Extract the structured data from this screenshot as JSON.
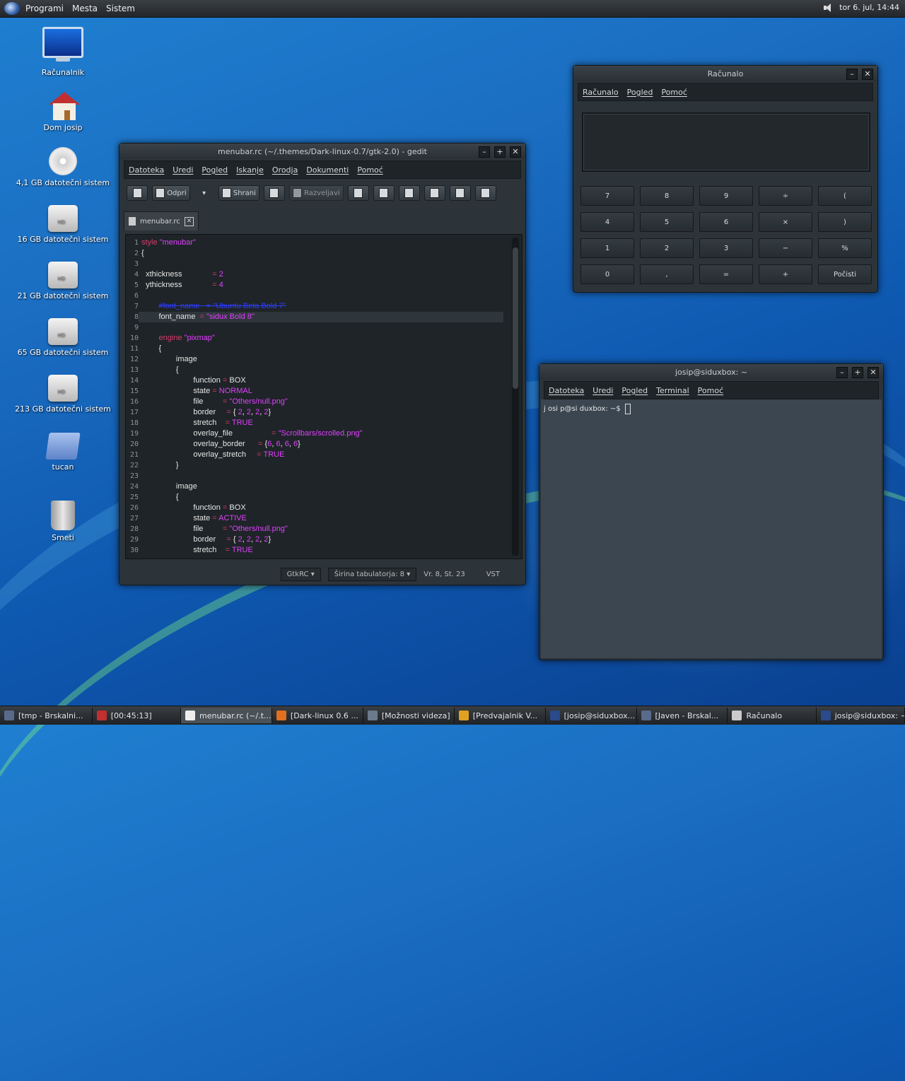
{
  "top_panel": {
    "menus": [
      "Programi",
      "Mesta",
      "Sistem"
    ],
    "clock": "tor  6. jul, 14:44"
  },
  "desktop_icons": [
    {
      "label": "Računalnik",
      "icon": "computer-icon"
    },
    {
      "label": "Dom josip",
      "icon": "home-folder-icon"
    },
    {
      "label": "4,1 GB datotečni sistem",
      "icon": "cd-drive-icon"
    },
    {
      "label": "16 GB datotečni sistem",
      "icon": "hard-drive-icon"
    },
    {
      "label": "21 GB datotečni sistem",
      "icon": "hard-drive-icon"
    },
    {
      "label": "65 GB datotečni sistem",
      "icon": "hard-drive-icon"
    },
    {
      "label": "213 GB datotečni sistem",
      "icon": "hard-drive-icon"
    },
    {
      "label": "tucan",
      "icon": "folder-icon"
    },
    {
      "label": "Smeti",
      "icon": "trash-icon"
    }
  ],
  "gedit": {
    "title": "menubar.rc (~/.themes/Dark-linux-0.7/gtk-2.0) - gedit",
    "menu": [
      "Datoteka",
      "Uredi",
      "Pogled",
      "Iskanje",
      "Orodja",
      "Dokumenti",
      "Pomoć"
    ],
    "toolbar": {
      "open": "Odpri",
      "save": "Shrani",
      "undo": "Razveljavi"
    },
    "tab": "menubar.rc",
    "line_numbers": [
      "1",
      "2",
      "3",
      "4",
      "5",
      "6",
      "7",
      "8",
      "9",
      "10",
      "11",
      "12",
      "13",
      "14",
      "15",
      "16",
      "17",
      "18",
      "19",
      "20",
      "21",
      "22",
      "23",
      "24",
      "25",
      "26",
      "27",
      "28",
      "29",
      "30"
    ],
    "status": {
      "lang": "GtkRC",
      "tab_width": "Širina tabulatorja:  8",
      "position": "Vr. 8, St. 23",
      "mode": "VST"
    }
  },
  "calculator": {
    "title": "Računalo",
    "menu": [
      "Računalo",
      "Pogled",
      "Pomoć"
    ],
    "buttons": [
      [
        "7",
        "8",
        "9",
        "÷",
        "("
      ],
      [
        "4",
        "5",
        "6",
        "×",
        ")"
      ],
      [
        "1",
        "2",
        "3",
        "−",
        "%"
      ],
      [
        "0",
        ",",
        "=",
        "+",
        "Počisti"
      ]
    ]
  },
  "terminal": {
    "title": "josip@siduxbox: ~",
    "menu": [
      "Datoteka",
      "Uredi",
      "Pogled",
      "Terminal",
      "Pomoć"
    ],
    "prompt": "j osi p@si duxbox: ~$"
  },
  "taskbar": [
    {
      "label": "[tmp - Brskalni...",
      "active": false
    },
    {
      "label": "[00:45:13]",
      "active": false
    },
    {
      "label": "menubar.rc (~/.t...",
      "active": true
    },
    {
      "label": "[Dark-linux 0.6 ...",
      "active": false
    },
    {
      "label": "[Možnosti videza]",
      "active": false
    },
    {
      "label": "[Predvajalnik V...",
      "active": false
    },
    {
      "label": "[josip@siduxbox...",
      "active": false
    },
    {
      "label": "[Javen - Brskal...",
      "active": false
    },
    {
      "label": "Računalo",
      "active": false
    },
    {
      "label": "josip@siduxbox: ~",
      "active": false
    }
  ],
  "colors": {
    "desktop": "#1b6ec2",
    "window": "#2c3339",
    "keyword": "#d43c6c",
    "string": "#e040ff"
  }
}
